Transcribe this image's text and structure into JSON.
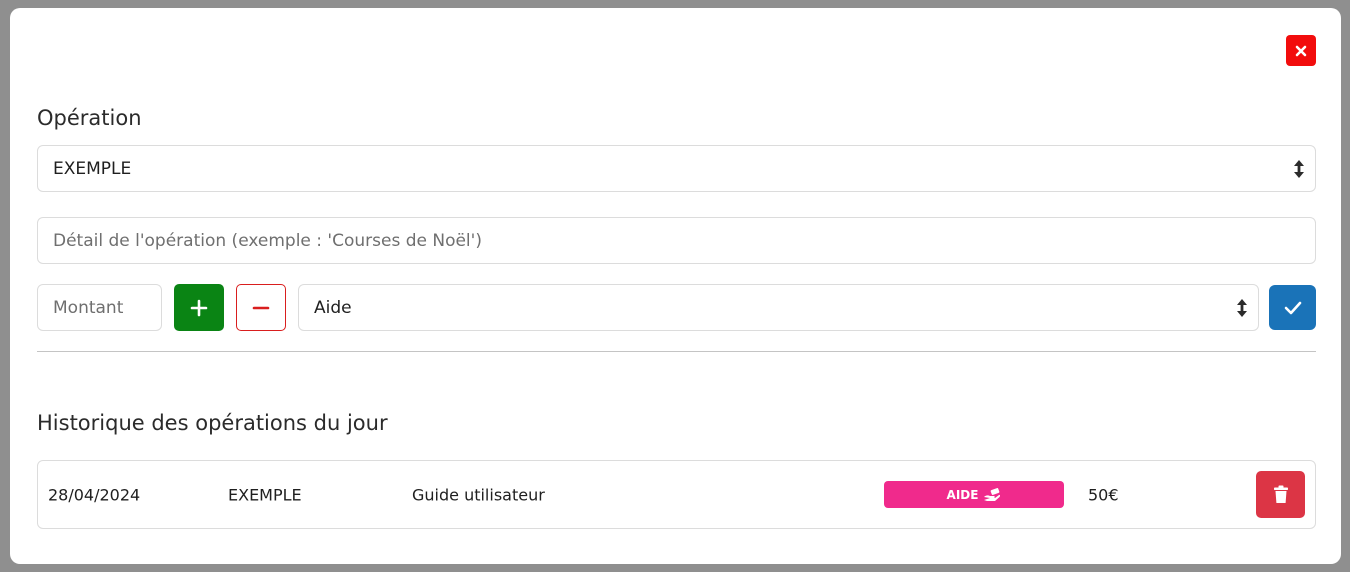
{
  "modal": {
    "close_icon": "close-icon",
    "close_color": "#f20d0d"
  },
  "operation": {
    "title": "Opération",
    "select_value": "EXEMPLE",
    "detail_placeholder": "Détail de l'opération (exemple : 'Courses de Noël')",
    "amount_placeholder": "Montant",
    "plus_icon": "plus-icon",
    "minus_icon": "minus-icon",
    "category_value": "Aide",
    "confirm_icon": "check-icon"
  },
  "history": {
    "title": "Historique des opérations du jour",
    "rows": [
      {
        "date": "28/04/2024",
        "operation": "EXEMPLE",
        "detail": "Guide utilisateur",
        "category_badge": "AIDE",
        "badge_icon": "hand-money-icon",
        "amount": "50€",
        "delete_icon": "trash-icon"
      }
    ]
  },
  "colors": {
    "plus": "#0a8414",
    "minus_border": "#d91e1e",
    "confirm": "#1a73b8",
    "badge": "#f02a8c",
    "delete": "#dc3545"
  }
}
